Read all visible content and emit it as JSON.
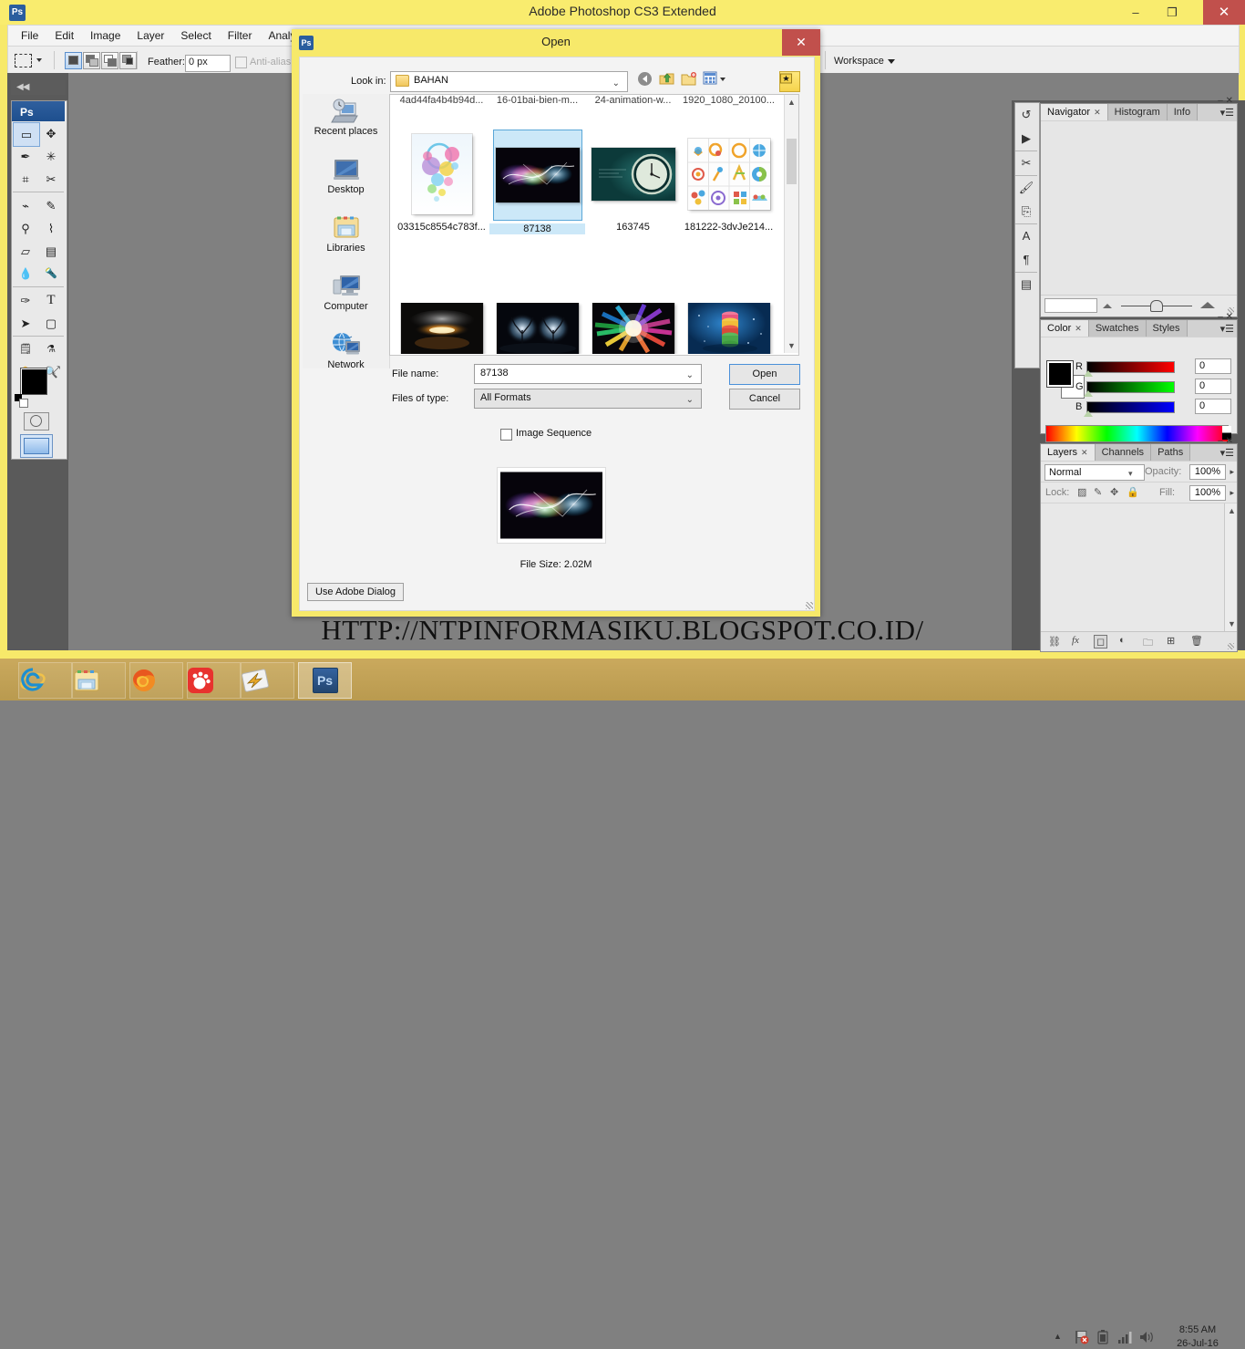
{
  "window": {
    "title": "Adobe Photoshop CS3 Extended",
    "app_icon": "Ps",
    "minimize": "–",
    "maximize": "❐",
    "close": "✕"
  },
  "menubar": {
    "items": [
      "File",
      "Edit",
      "Image",
      "Layer",
      "Select",
      "Filter",
      "Analysis"
    ]
  },
  "options_bar": {
    "feather_label": "Feather:",
    "feather_value": "0 px",
    "antialias_label": "Anti-alias",
    "workspace_label": "Workspace"
  },
  "toolbox": {
    "header": "Ps",
    "tools": [
      {
        "name": "rectangular-marquee-tool",
        "glyph": "▭",
        "selected": true
      },
      {
        "name": "move-tool",
        "glyph": "✥",
        "selected": false
      },
      {
        "name": "lasso-tool",
        "glyph": "✒",
        "selected": false
      },
      {
        "name": "magic-wand-tool",
        "glyph": "✳",
        "selected": false
      },
      {
        "name": "crop-tool",
        "glyph": "⌗",
        "selected": false
      },
      {
        "name": "slice-tool",
        "glyph": "✂",
        "selected": false
      },
      {
        "name": "healing-brush-tool",
        "glyph": "⌁",
        "selected": false
      },
      {
        "name": "brush-tool",
        "glyph": "✎",
        "selected": false
      },
      {
        "name": "clone-stamp-tool",
        "glyph": "⚲",
        "selected": false
      },
      {
        "name": "history-brush-tool",
        "glyph": "⌇",
        "selected": false
      },
      {
        "name": "eraser-tool",
        "glyph": "▱",
        "selected": false
      },
      {
        "name": "gradient-tool",
        "glyph": "▤",
        "selected": false
      },
      {
        "name": "blur-tool",
        "glyph": "💧",
        "selected": false
      },
      {
        "name": "dodge-tool",
        "glyph": "🔦",
        "selected": false
      },
      {
        "name": "pen-tool",
        "glyph": "✑",
        "selected": false
      },
      {
        "name": "type-tool",
        "glyph": "T",
        "selected": false
      },
      {
        "name": "path-selection-tool",
        "glyph": "➤",
        "selected": false
      },
      {
        "name": "rectangle-shape-tool",
        "glyph": "▢",
        "selected": false
      },
      {
        "name": "notes-tool",
        "glyph": "🗒",
        "selected": false
      },
      {
        "name": "eyedropper-tool",
        "glyph": "⚗",
        "selected": false
      },
      {
        "name": "hand-tool",
        "glyph": "✋",
        "selected": false
      },
      {
        "name": "zoom-tool",
        "glyph": "🔍",
        "selected": false
      }
    ],
    "foreground_color": "#000000",
    "background_color": "#ffffff"
  },
  "dialog": {
    "title": "Open",
    "icon": "Ps",
    "close": "✕",
    "look_in_label": "Look in:",
    "look_in_value": "BAHAN",
    "nav_buttons": [
      {
        "name": "back-button",
        "glyph": "◀"
      },
      {
        "name": "up-one-level-button",
        "glyph": "⬆"
      },
      {
        "name": "new-folder-button",
        "glyph": "🗀"
      },
      {
        "name": "views-button",
        "glyph": "▦"
      },
      {
        "name": "adobe-extras-button",
        "glyph": "✷"
      }
    ],
    "places": [
      {
        "label": "Recent places",
        "icon": "recent-places-icon"
      },
      {
        "label": "Desktop",
        "icon": "desktop-icon"
      },
      {
        "label": "Libraries",
        "icon": "libraries-icon"
      },
      {
        "label": "Computer",
        "icon": "computer-icon"
      },
      {
        "label": "Network",
        "icon": "network-icon"
      }
    ],
    "partial_row_names": [
      "4ad44fa4b4b94d...",
      "16-01bai-bien-m...",
      "24-animation-w...",
      "1920_1080_20100..."
    ],
    "files_row1": [
      {
        "name": "03315c8554c783f...",
        "selected": false,
        "thumb": "bubbles"
      },
      {
        "name": "87138",
        "selected": true,
        "thumb": "neon"
      },
      {
        "name": "163745",
        "selected": false,
        "thumb": "clock"
      },
      {
        "name": "181222-3dvJe214...",
        "selected": false,
        "thumb": "icons"
      }
    ],
    "files_row2": [
      {
        "name": "",
        "selected": false,
        "thumb": "explosion"
      },
      {
        "name": "",
        "selected": false,
        "thumb": "tree"
      },
      {
        "name": "",
        "selected": false,
        "thumb": "burst"
      },
      {
        "name": "",
        "selected": false,
        "thumb": "candy"
      }
    ],
    "file_name_label": "File name:",
    "file_name_value": "87138",
    "files_of_type_label": "Files of type:",
    "files_of_type_value": "All Formats",
    "open_button": "Open",
    "cancel_button": "Cancel",
    "image_sequence_label": "Image Sequence",
    "image_sequence_checked": false,
    "file_size_text": "File Size: 2.02M",
    "use_adobe_dialog_button": "Use Adobe Dialog"
  },
  "panels": {
    "navigator": {
      "tabs": [
        "Navigator",
        "Histogram",
        "Info"
      ],
      "active_tab": "Navigator",
      "zoom_value": ""
    },
    "color": {
      "tabs": [
        "Color",
        "Swatches",
        "Styles"
      ],
      "active_tab": "Color",
      "channels": [
        {
          "label": "R",
          "value": "0",
          "color": "#ff0000"
        },
        {
          "label": "G",
          "value": "0",
          "color": "#00ff00"
        },
        {
          "label": "B",
          "value": "0",
          "color": "#0000ff"
        }
      ]
    },
    "layers": {
      "tabs": [
        "Layers",
        "Channels",
        "Paths"
      ],
      "active_tab": "Layers",
      "blend_mode": "Normal",
      "opacity_label": "Opacity:",
      "opacity_value": "100%",
      "lock_label": "Lock:",
      "fill_label": "Fill:",
      "fill_value": "100%",
      "footer_icons": [
        {
          "name": "link-layers-icon",
          "glyph": "⛓"
        },
        {
          "name": "layer-style-icon",
          "glyph": "fx"
        },
        {
          "name": "layer-mask-icon",
          "glyph": "◻"
        },
        {
          "name": "adjustment-layer-icon",
          "glyph": "◐"
        },
        {
          "name": "new-group-icon",
          "glyph": "🗀"
        },
        {
          "name": "new-layer-icon",
          "glyph": "⊞"
        },
        {
          "name": "delete-layer-icon",
          "glyph": "🗑"
        }
      ]
    },
    "dock_icons": [
      {
        "name": "history-panel-icon",
        "glyph": "↺"
      },
      {
        "name": "actions-panel-icon",
        "glyph": "▶"
      },
      {
        "name": "tool-presets-panel-icon",
        "glyph": "✂"
      },
      {
        "name": "brushes-panel-icon",
        "glyph": "🖌"
      },
      {
        "name": "clone-source-panel-icon",
        "glyph": "⎘"
      },
      {
        "name": "character-panel-icon",
        "glyph": "A"
      },
      {
        "name": "paragraph-panel-icon",
        "glyph": "¶"
      },
      {
        "name": "layer-comps-panel-icon",
        "glyph": "▤"
      }
    ]
  },
  "watermark": {
    "text": "HTTP://NTPINFORMASIKU.BLOGSPOT.CO.ID/"
  },
  "taskbar": {
    "items": [
      {
        "name": "internet-explorer-taskbar-icon",
        "label": "e",
        "active": false
      },
      {
        "name": "file-explorer-taskbar-icon",
        "label": "folder",
        "active": false
      },
      {
        "name": "firefox-taskbar-icon",
        "label": "firefox",
        "active": false
      },
      {
        "name": "gom-player-taskbar-icon",
        "label": "gom",
        "active": false
      },
      {
        "name": "winamp-taskbar-icon",
        "label": "winamp",
        "active": false
      },
      {
        "name": "photoshop-taskbar-icon",
        "label": "Ps",
        "active": true
      }
    ],
    "tray_icons": [
      {
        "name": "show-hidden-icons-icon",
        "glyph": "▲"
      },
      {
        "name": "network-error-icon",
        "glyph": "🚩"
      },
      {
        "name": "battery-icon",
        "glyph": "🔋"
      },
      {
        "name": "signal-icon",
        "glyph": "📶"
      },
      {
        "name": "volume-icon",
        "glyph": "🔊"
      }
    ],
    "clock_time": "8:55 AM",
    "clock_date": "26-Jul-16"
  },
  "colors": {
    "title_bar": "#f9ec6e",
    "close_button": "#c1504c",
    "selection_blue": "#cce8f8",
    "canvas_gray": "#808080",
    "taskbar": "#caa95d"
  }
}
